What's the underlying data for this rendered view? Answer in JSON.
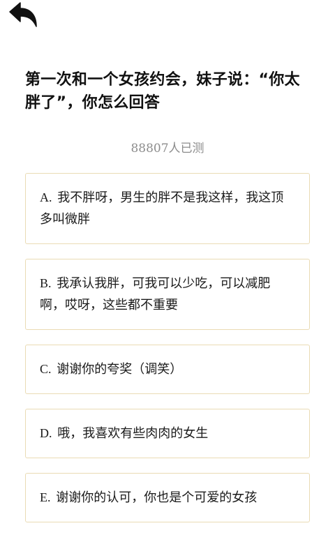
{
  "header": {
    "back_icon": "back-arrow-icon"
  },
  "question": {
    "text": "第一次和一个女孩约会，妹子说：“你太胖了”，你怎么回答"
  },
  "participants": {
    "text": "88807人已测"
  },
  "options": [
    {
      "letter": "A.",
      "text": "我不胖呀，男生的胖不是我这样，我这顶多叫微胖"
    },
    {
      "letter": "B.",
      "text": "我承认我胖，可我可以少吃，可以减肥啊，哎呀，这些都不重要"
    },
    {
      "letter": "C.",
      "text": "谢谢你的夸奖（调笑）"
    },
    {
      "letter": "D.",
      "text": "哦，我喜欢有些肉肉的女生"
    },
    {
      "letter": "E.",
      "text": "谢谢你的认可，你也是个可爱的女孩"
    }
  ],
  "colors": {
    "option_border": "#eadbb4",
    "count_text": "#8c8c8c",
    "question_text": "#111111"
  }
}
